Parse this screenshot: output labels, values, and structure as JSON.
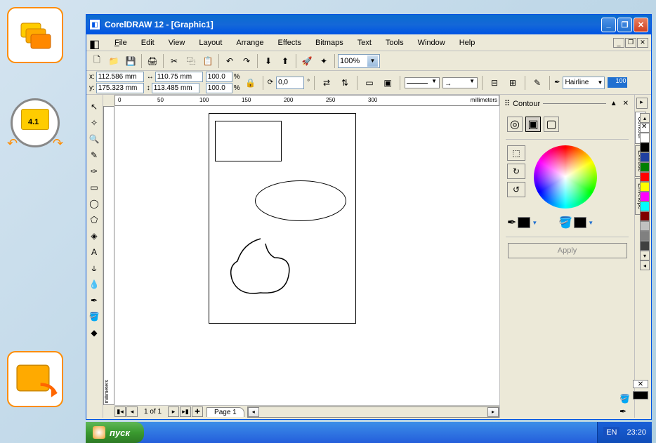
{
  "titlebar": {
    "title": "CorelDRAW 12 - [Graphic1]"
  },
  "menu": {
    "file": "File",
    "edit": "Edit",
    "view": "View",
    "layout": "Layout",
    "arrange": "Arrange",
    "effects": "Effects",
    "bitmaps": "Bitmaps",
    "text": "Text",
    "tools": "Tools",
    "window": "Window",
    "help": "Help"
  },
  "toolbar": {
    "zoom": "100%"
  },
  "propbar": {
    "x_label": "x:",
    "x": "112.586 mm",
    "y_label": "y:",
    "y": "175.323 mm",
    "w": "110.75 mm",
    "h": "113.485 mm",
    "sx": "100.0",
    "sy": "100.0",
    "pct": "%",
    "rot": "0,0",
    "deg": "°",
    "outline": "Hairline",
    "outline_pct": "100"
  },
  "ruler": {
    "h_unit": "millimeters",
    "v_unit": "millimeters",
    "ticks": [
      "0",
      "50",
      "100",
      "150",
      "200",
      "250",
      "300"
    ]
  },
  "page_nav": {
    "counter": "1 of 1",
    "tab": "Page 1"
  },
  "docker": {
    "title": "Contour",
    "tabs": {
      "contour": "Contour",
      "extrude": "Extrude",
      "envelope": "Envelope"
    },
    "apply": "Apply"
  },
  "palette": [
    "#ffffff",
    "#000000",
    "#2040a0",
    "#008000",
    "#ff0000",
    "#ffff00",
    "#ff00ff",
    "#00ffff",
    "#800000",
    "#c0c0c0",
    "#808080",
    "#404040"
  ],
  "taskbar": {
    "start": "пуск",
    "lang": "EN",
    "clock": "23:20"
  },
  "sidebar": {
    "version": "4.1"
  }
}
